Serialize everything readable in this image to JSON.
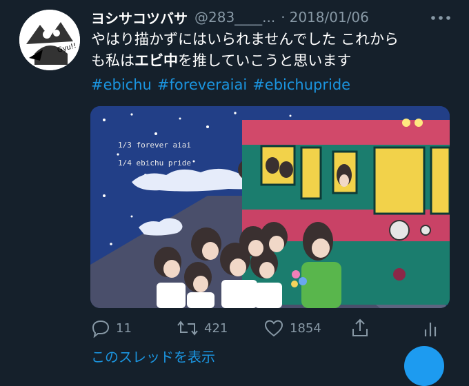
{
  "tweet": {
    "display_name": "ヨシサコツバサ",
    "handle": "@283____...",
    "separator": "·",
    "date": "2018/01/06",
    "text_line1": "やはり描かずにはいられませんでした これから",
    "text_line2_pre": "も私は",
    "text_line2_bold": "エビ中",
    "text_line2_post": "を推していこうと思います",
    "hashtags": [
      "#ebichu",
      "#foreveraiai",
      "#ebichupride"
    ],
    "image_text": {
      "line1": "1/3 forever aiai",
      "line2": "1/4 ebichu pride"
    },
    "avatar_text": "Gyu!!"
  },
  "actions": {
    "reply_count": "11",
    "retweet_count": "421",
    "like_count": "1854"
  },
  "thread_link": "このスレッドを表示",
  "icons": [
    "reply-icon",
    "retweet-icon",
    "like-icon",
    "share-icon",
    "analytics-icon",
    "more-icon"
  ],
  "colors": {
    "background": "#15202b",
    "link": "#1b95e0",
    "muted": "#8899a6"
  }
}
